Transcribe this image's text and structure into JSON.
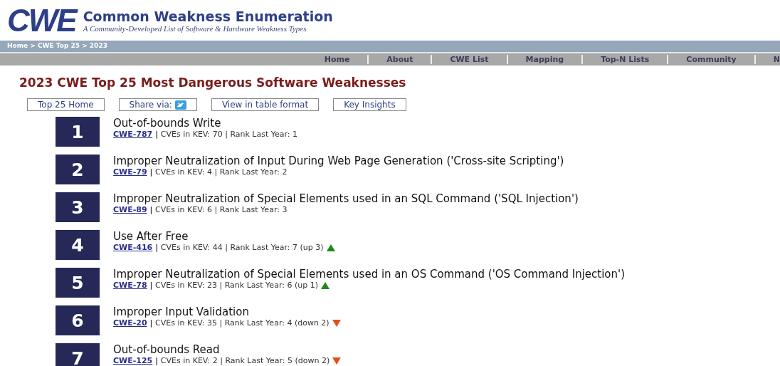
{
  "header": {
    "logo": "CWE",
    "title": "Common Weakness Enumeration",
    "subtitle": "A Community-Developed List of Software & Hardware Weakness Types"
  },
  "breadcrumb": "Home > CWE Top 25 > 2023",
  "nav": [
    "Home",
    "About",
    "CWE List",
    "Mapping",
    "Top-N Lists",
    "Community",
    "N"
  ],
  "page_title": "2023 CWE Top 25 Most Dangerous Software Weaknesses",
  "actions": [
    {
      "kind": "link",
      "label": "Top 25 Home"
    },
    {
      "kind": "share",
      "label": "Share via:"
    },
    {
      "kind": "link",
      "label": "View in table format"
    },
    {
      "kind": "link",
      "label": "Key Insights"
    }
  ],
  "weaknesses": [
    {
      "rank": "1",
      "title": "Out-of-bounds Write",
      "cwe": "CWE-787",
      "meta": "**|** CVEs in KEV: 70 | Rank Last Year: 1",
      "kind": "steady"
    },
    {
      "rank": "2",
      "title": "Improper Neutralization of Input During Web Page Generation ('Cross-site Scripting')",
      "cwe": "CWE-79",
      "meta": "**|** CVEs in KEV: 4 | Rank Last Year: 2",
      "kind": "steady"
    },
    {
      "rank": "3",
      "title": "Improper Neutralization of Special Elements used in an SQL Command ('SQL Injection')",
      "cwe": "CWE-89",
      "meta": "**|** CVEs in KEV: 6 | Rank Last Year: 3",
      "kind": "steady"
    },
    {
      "rank": "4",
      "title": "Use After Free",
      "cwe": "CWE-416",
      "meta": "**|** CVEs in KEV: 44 | Rank Last Year: 7 (up 3)",
      "kind": "up"
    },
    {
      "rank": "5",
      "title": "Improper Neutralization of Special Elements used in an OS Command ('OS Command Injection')",
      "cwe": "CWE-78",
      "meta": "**|** CVEs in KEV: 23 | Rank Last Year: 6 (up 1)",
      "kind": "up"
    },
    {
      "rank": "6",
      "title": "Improper Input Validation",
      "cwe": "CWE-20",
      "meta": "**|** CVEs in KEV: 35 | Rank Last Year: 4 (down 2)",
      "kind": "down"
    },
    {
      "rank": "7",
      "title": "Out-of-bounds Read",
      "cwe": "CWE-125",
      "meta": "**|** CVEs in KEV: 2 | Rank Last Year: 5 (down 2)",
      "kind": "down"
    }
  ]
}
